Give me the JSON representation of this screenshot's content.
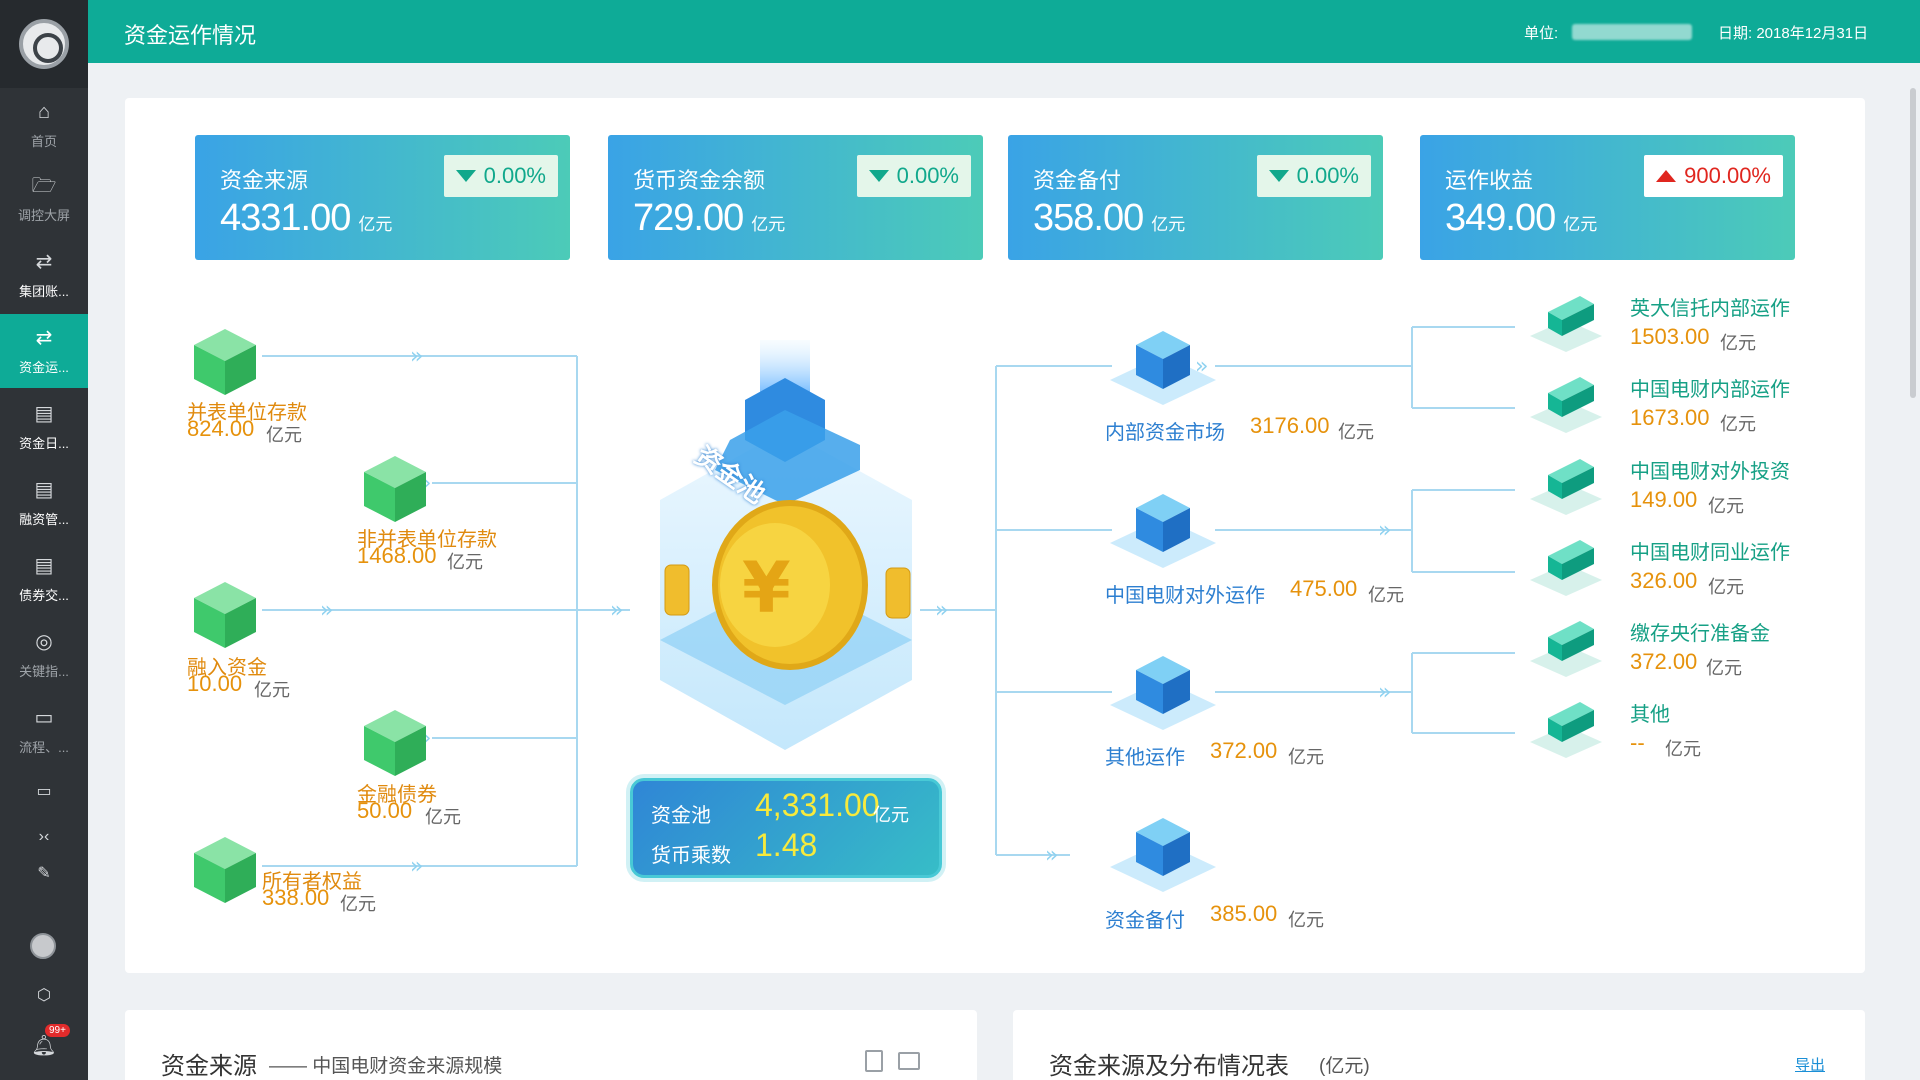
{
  "app": {
    "title": "资金运作情况"
  },
  "header": {
    "unit_label": "单位:",
    "date_label": "日期:",
    "date_value": "2018年12月31日"
  },
  "sidebar": {
    "items": [
      {
        "label": "首页",
        "icon": "home-icon"
      },
      {
        "label": "调控大屏",
        "icon": "folder-icon"
      },
      {
        "label": "集团账...",
        "icon": "exchange-icon"
      },
      {
        "label": "资金运...",
        "icon": "exchange-icon"
      },
      {
        "label": "资金日...",
        "icon": "ledger-icon"
      },
      {
        "label": "融资管...",
        "icon": "ledger-icon"
      },
      {
        "label": "债券交...",
        "icon": "ledger-icon"
      },
      {
        "label": "关键指...",
        "icon": "gauge-icon"
      },
      {
        "label": "流程、...",
        "icon": "folder-icon"
      }
    ],
    "badge": "99+"
  },
  "kpis": [
    {
      "label": "资金来源",
      "value": "4331.00",
      "unit": "亿元",
      "change": "0.00%",
      "direction": "down"
    },
    {
      "label": "货币资金余额",
      "value": "729.00",
      "unit": "亿元",
      "change": "0.00%",
      "direction": "down"
    },
    {
      "label": "资金备付",
      "value": "358.00",
      "unit": "亿元",
      "change": "0.00%",
      "direction": "down"
    },
    {
      "label": "运作收益",
      "value": "349.00",
      "unit": "亿元",
      "change": "900.00%",
      "direction": "up"
    }
  ],
  "sources": [
    {
      "label": "并表单位存款",
      "value": "824.00",
      "unit": "亿元"
    },
    {
      "label": "非并表单位存款",
      "value": "1468.00",
      "unit": "亿元"
    },
    {
      "label": "融入资金",
      "value": "10.00",
      "unit": "亿元"
    },
    {
      "label": "金融债券",
      "value": "50.00",
      "unit": "亿元"
    },
    {
      "label": "所有者权益",
      "value": "338.00",
      "unit": "亿元"
    }
  ],
  "pool": {
    "icon_text": "资金池",
    "pool_label": "资金池",
    "pool_value": "4,331.00",
    "pool_unit": "亿元",
    "multiplier_label": "货币乘数",
    "multiplier_value": "1.48"
  },
  "middle": [
    {
      "label": "内部资金市场",
      "value": "3176.00",
      "unit": "亿元"
    },
    {
      "label": "中国电财对外运作",
      "value": "475.00",
      "unit": "亿元"
    },
    {
      "label": "其他运作",
      "value": "372.00",
      "unit": "亿元"
    },
    {
      "label": "资金备付",
      "value": "385.00",
      "unit": "亿元"
    }
  ],
  "uses": [
    {
      "label": "英大信托内部运作",
      "value": "1503.00",
      "unit": "亿元"
    },
    {
      "label": "中国电财内部运作",
      "value": "1673.00",
      "unit": "亿元"
    },
    {
      "label": "中国电财对外投资",
      "value": "149.00",
      "unit": "亿元"
    },
    {
      "label": "中国电财同业运作",
      "value": "326.00",
      "unit": "亿元"
    },
    {
      "label": "缴存央行准备金",
      "value": "372.00",
      "unit": "亿元"
    },
    {
      "label": "其他",
      "value": "--",
      "unit": "亿元"
    }
  ],
  "cards": {
    "left": {
      "title": "资金来源",
      "subtitle": "—— 中国电财资金来源规模"
    },
    "right": {
      "title": "资金来源及分布情况表",
      "subtitle": "(亿元)",
      "export_label": "导出"
    }
  },
  "colors": {
    "primary": "#0eab97",
    "sidebar": "#2f3337",
    "orange_value": "#e6920c",
    "blue_label": "#2d7fd0",
    "up_red": "#e0261f",
    "down_green": "#11a88c"
  }
}
